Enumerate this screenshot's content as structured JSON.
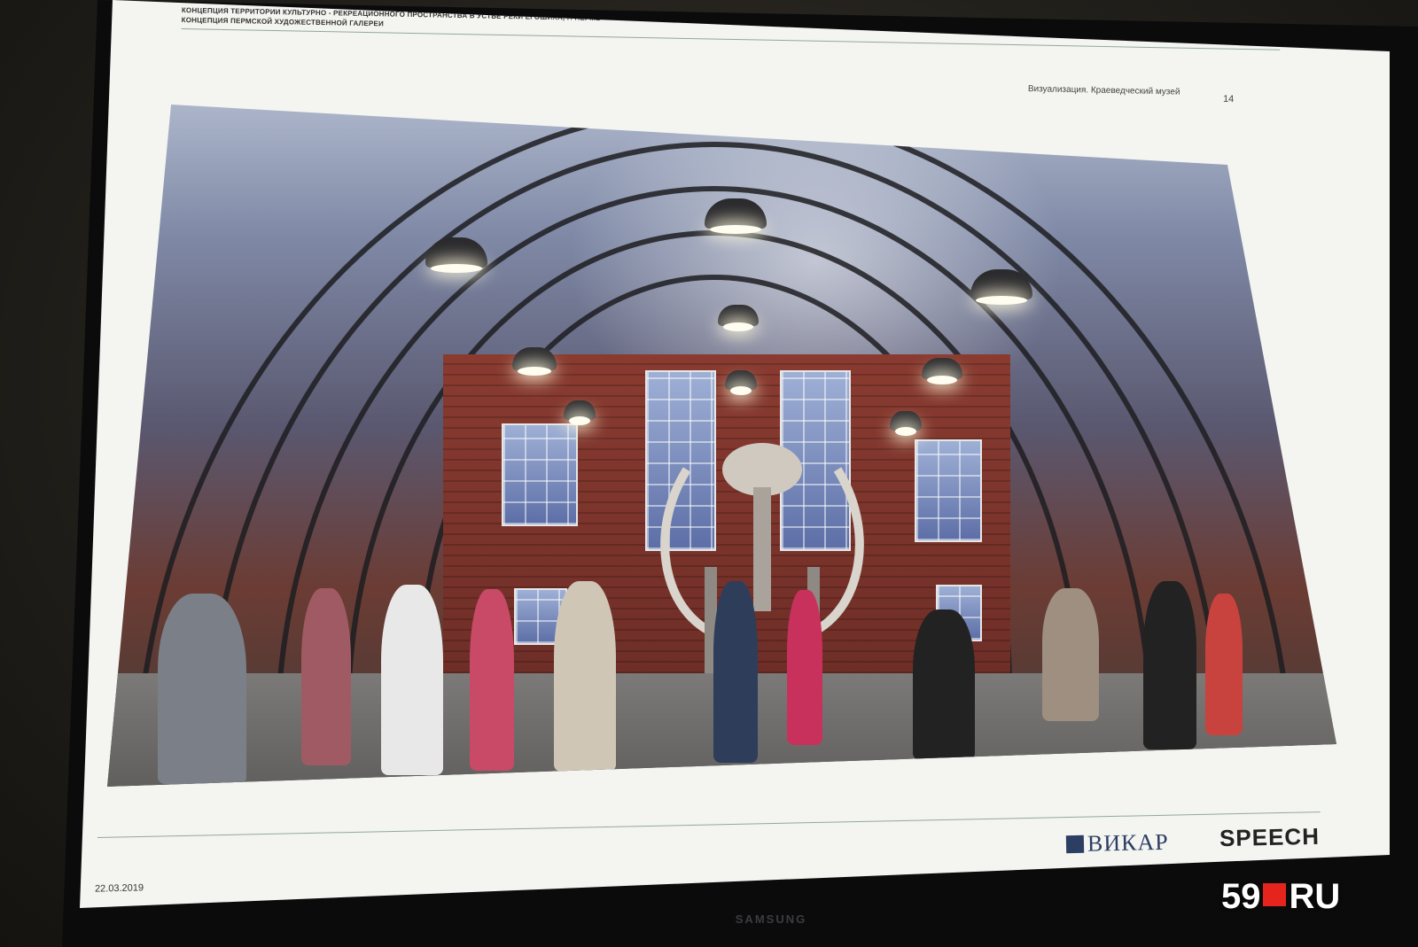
{
  "slide": {
    "header_line1": "КОНЦЕПЦИЯ ТЕРРИТОРИИ КУЛЬТУРНО - РЕКРЕАЦИОННОГО ПРОСТРАНСТВА В УСТЬЕ РЕКИ ЕГОШИХА, Г. ПЕРМЬ",
    "header_line2": "КОНЦЕПЦИЯ ПЕРМСКОЙ ХУДОЖЕСТВЕННОЙ ГАЛЕРЕИ",
    "caption": "Визуализация. Краеведческий музей",
    "page_number": "14",
    "date": "22.03.2019",
    "logo_vikar": "ВИКАР",
    "logo_speech": "SPEECH"
  },
  "monitor": {
    "brand": "SAMSUNG"
  },
  "watermark": {
    "number": "59",
    "suffix": "RU",
    "accent_color": "#e5241d"
  },
  "colors": {
    "brick": "#8a3b30",
    "steel": "#1e1e22",
    "slide_background": "#f4f5f1"
  }
}
